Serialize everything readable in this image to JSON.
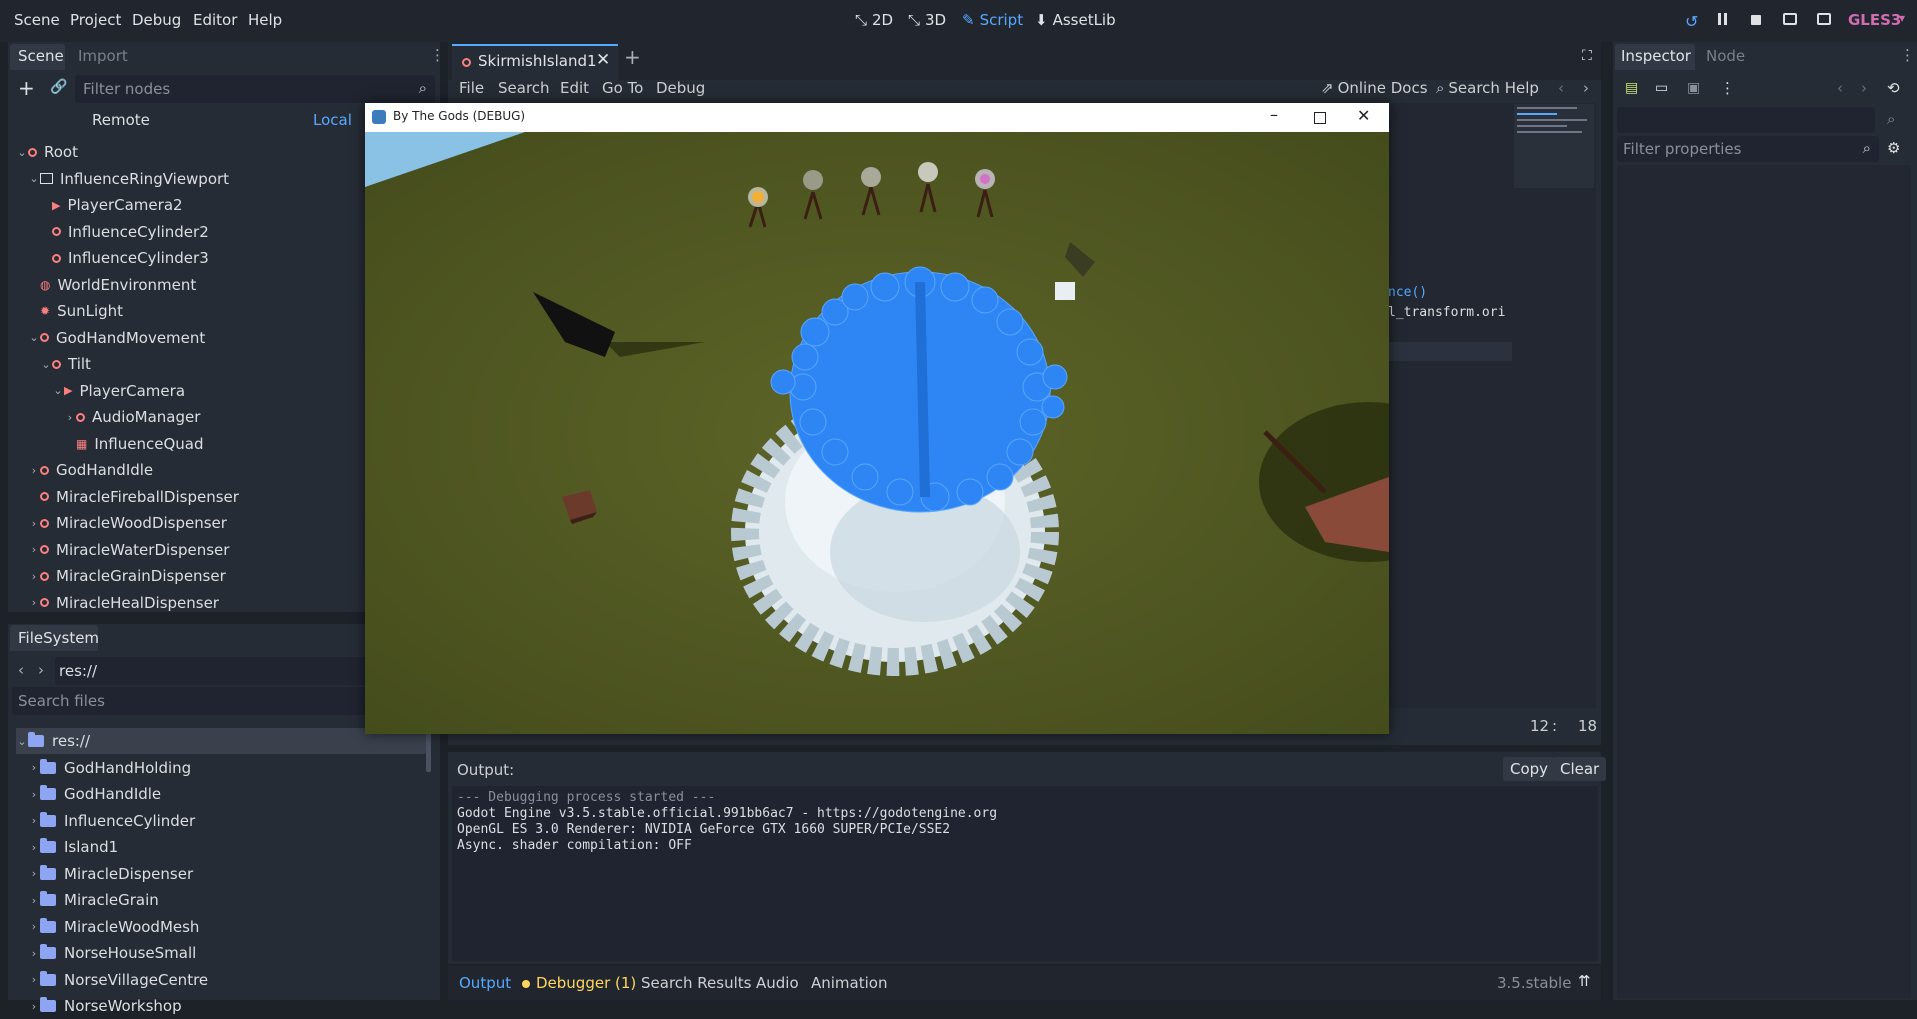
{
  "menubar": {
    "menus": [
      "Scene",
      "Project",
      "Debug",
      "Editor",
      "Help"
    ],
    "modes": [
      {
        "label": "2D",
        "icon": "2d-icon"
      },
      {
        "label": "3D",
        "icon": "3d-icon"
      },
      {
        "label": "Script",
        "icon": "script-icon"
      },
      {
        "label": "AssetLib",
        "icon": "assetlib-icon"
      }
    ],
    "renderer": "GLES3"
  },
  "scene_dock": {
    "tabs": [
      "Scene",
      "Import"
    ],
    "filter_placeholder": "Filter nodes",
    "remote_label": "Remote",
    "local_label": "Local",
    "nodes": [
      {
        "label": "Root",
        "depth": 0,
        "expand": "v"
      },
      {
        "label": "InfluenceRingViewport",
        "depth": 1,
        "expand": "v"
      },
      {
        "label": "PlayerCamera2",
        "depth": 2,
        "expand": ""
      },
      {
        "label": "InfluenceCylinder2",
        "depth": 2,
        "expand": ""
      },
      {
        "label": "InfluenceCylinder3",
        "depth": 2,
        "expand": ""
      },
      {
        "label": "WorldEnvironment",
        "depth": 1,
        "expand": ""
      },
      {
        "label": "SunLight",
        "depth": 1,
        "expand": ""
      },
      {
        "label": "GodHandMovement",
        "depth": 1,
        "expand": "v"
      },
      {
        "label": "Tilt",
        "depth": 2,
        "expand": "v"
      },
      {
        "label": "PlayerCamera",
        "depth": 3,
        "expand": "v"
      },
      {
        "label": "AudioManager",
        "depth": 4,
        "expand": ">"
      },
      {
        "label": "InfluenceQuad",
        "depth": 4,
        "expand": ""
      },
      {
        "label": "GodHandIdle",
        "depth": 1,
        "expand": ">"
      },
      {
        "label": "MiracleFireballDispenser",
        "depth": 1,
        "expand": ""
      },
      {
        "label": "MiracleWoodDispenser",
        "depth": 1,
        "expand": ">"
      },
      {
        "label": "MiracleWaterDispenser",
        "depth": 1,
        "expand": ">"
      },
      {
        "label": "MiracleGrainDispenser",
        "depth": 1,
        "expand": ">"
      },
      {
        "label": "MiracleHealDispenser",
        "depth": 1,
        "expand": ">"
      }
    ]
  },
  "filesystem_dock": {
    "tab": "FileSystem",
    "path": "res://",
    "search_placeholder": "Search files",
    "items": [
      "res://",
      "GodHandHolding",
      "GodHandIdle",
      "InfluenceCylinder",
      "Island1",
      "MiracleDispenser",
      "MiracleGrain",
      "MiracleWoodMesh",
      "NorseHouseSmall",
      "NorseVillageCentre",
      "NorseWorkshop"
    ]
  },
  "script_editor": {
    "tab": "SkirmishIsland1",
    "menus": [
      "File",
      "Search",
      "Edit",
      "Go To",
      "Debug"
    ],
    "online_docs": "Online Docs",
    "search_help": "Search Help",
    "code_fragments": [
      "nce()",
      "l_transform.ori"
    ],
    "line": "12",
    "col": "18",
    "colon": ":"
  },
  "game_window": {
    "title": "By The Gods (DEBUG)"
  },
  "output": {
    "label": "Output:",
    "copy": "Copy",
    "clear": "Clear",
    "lines": [
      "--- Debugging process started ---",
      "Godot Engine v3.5.stable.official.991bb6ac7 - https://godotengine.org",
      "OpenGL ES 3.0 Renderer: NVIDIA GeForce GTX 1660 SUPER/PCIe/SSE2",
      "Async. shader compilation: OFF"
    ]
  },
  "bottom_tabs": [
    "Output",
    "Debugger (1)",
    "Search Results",
    "Audio",
    "Animation"
  ],
  "version": "3.5.stable",
  "inspector": {
    "tabs": [
      "Inspector",
      "Node"
    ],
    "filter_placeholder": "Filter properties"
  },
  "colors": {
    "accent": "#57a8ff",
    "node_ring": "#fc7f7f",
    "folder": "#8da5f3",
    "ground": "#5b6327",
    "water_spheres": "#2e86f5"
  }
}
